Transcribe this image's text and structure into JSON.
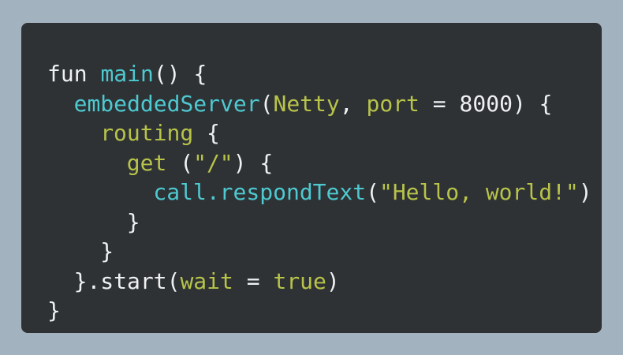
{
  "code": {
    "lines": [
      {
        "indent": 0,
        "tokens": [
          {
            "text": "fun ",
            "kind": "kw"
          },
          {
            "text": "main",
            "kind": "fn"
          },
          {
            "text": "() {",
            "kind": "plain"
          }
        ]
      },
      {
        "indent": 1,
        "tokens": [
          {
            "text": "embeddedServer",
            "kind": "call"
          },
          {
            "text": "(",
            "kind": "plain"
          },
          {
            "text": "Netty",
            "kind": "type"
          },
          {
            "text": ", ",
            "kind": "plain"
          },
          {
            "text": "port",
            "kind": "param"
          },
          {
            "text": " = ",
            "kind": "plain"
          },
          {
            "text": "8000",
            "kind": "num"
          },
          {
            "text": ") {",
            "kind": "plain"
          }
        ]
      },
      {
        "indent": 2,
        "tokens": [
          {
            "text": "routing",
            "kind": "type"
          },
          {
            "text": " {",
            "kind": "plain"
          }
        ]
      },
      {
        "indent": 3,
        "tokens": [
          {
            "text": "get",
            "kind": "type"
          },
          {
            "text": " (",
            "kind": "plain"
          },
          {
            "text": "\"/\"",
            "kind": "str"
          },
          {
            "text": ") {",
            "kind": "plain"
          }
        ]
      },
      {
        "indent": 4,
        "tokens": [
          {
            "text": "call.respondText",
            "kind": "call"
          },
          {
            "text": "(",
            "kind": "plain"
          },
          {
            "text": "\"Hello, world!\"",
            "kind": "str"
          },
          {
            "text": ")",
            "kind": "plain"
          }
        ]
      },
      {
        "indent": 3,
        "tokens": [
          {
            "text": "}",
            "kind": "plain"
          }
        ]
      },
      {
        "indent": 2,
        "tokens": [
          {
            "text": "}",
            "kind": "plain"
          }
        ]
      },
      {
        "indent": 1,
        "tokens": [
          {
            "text": "}.start(",
            "kind": "plain"
          },
          {
            "text": "wait",
            "kind": "param"
          },
          {
            "text": " = ",
            "kind": "plain"
          },
          {
            "text": "true",
            "kind": "type"
          },
          {
            "text": ")",
            "kind": "plain"
          }
        ]
      },
      {
        "indent": 0,
        "tokens": [
          {
            "text": "}",
            "kind": "plain"
          }
        ]
      }
    ]
  },
  "colors": {
    "background": "#a3b2bf",
    "panel": "#2e3235",
    "text": "#eff0f1",
    "function": "#4ec9d0",
    "type_string": "#b8c34a"
  }
}
